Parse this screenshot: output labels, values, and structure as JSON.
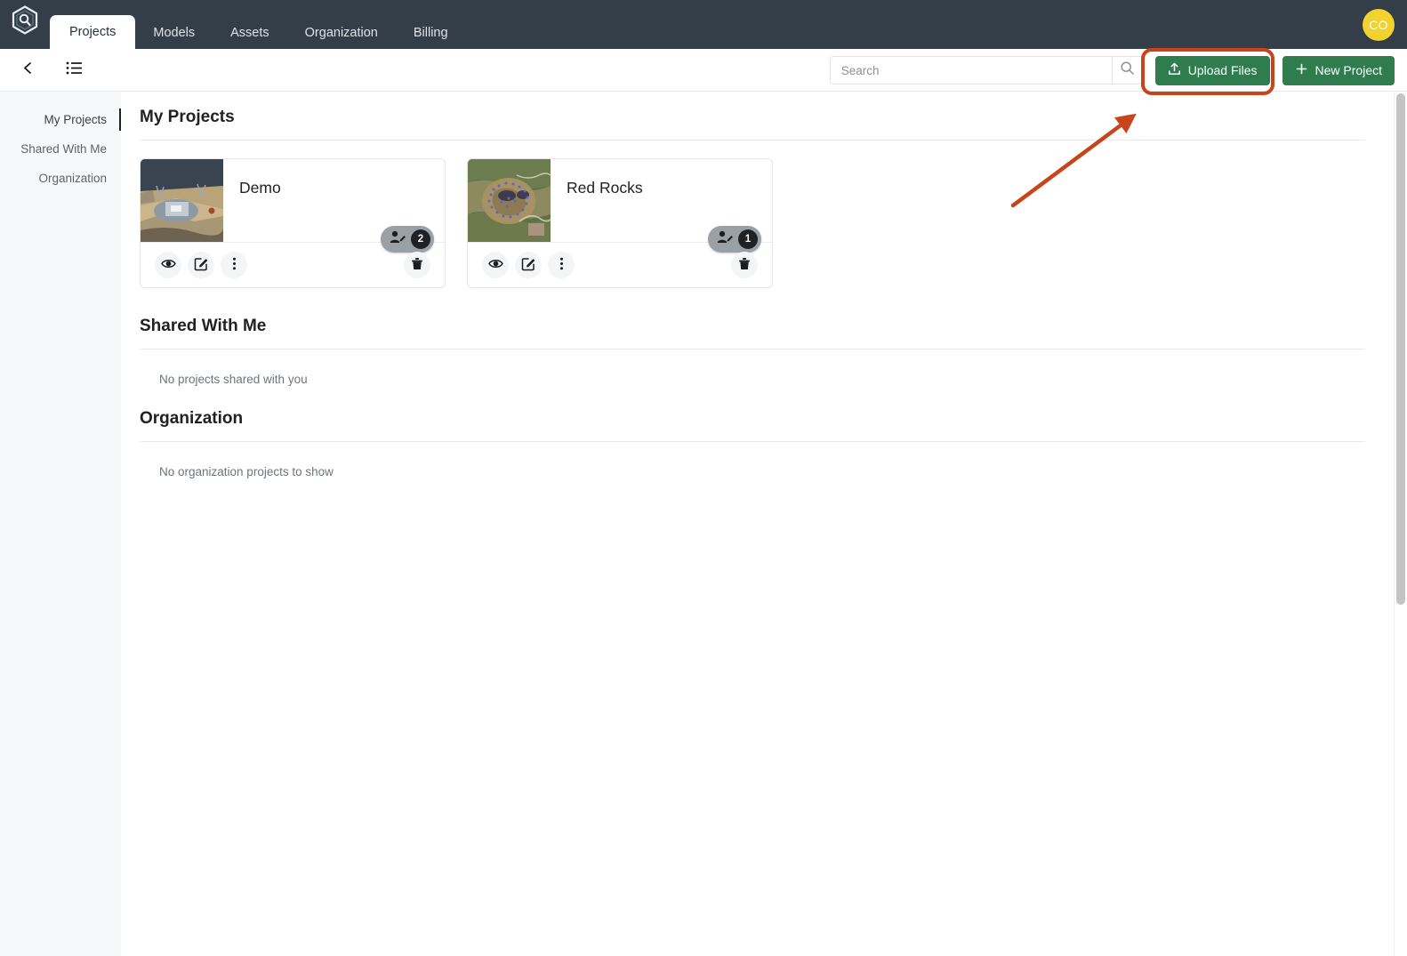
{
  "topnav": {
    "logo_icon": "hexagon-magnifier-logo",
    "tabs": [
      {
        "label": "Projects",
        "active": true
      },
      {
        "label": "Models",
        "active": false
      },
      {
        "label": "Assets",
        "active": false
      },
      {
        "label": "Organization",
        "active": false
      },
      {
        "label": "Billing",
        "active": false
      }
    ],
    "avatar_initials": "CO",
    "avatar_color": "#f2d22e",
    "background": "#333e48"
  },
  "toolbar": {
    "back_icon": "chevron-left-icon",
    "list_icon": "list-view-icon",
    "search": {
      "placeholder": "Search",
      "value": "",
      "button_icon": "search-icon"
    },
    "upload_label": "Upload Files",
    "upload_icon": "upload-icon",
    "new_project_label": "New Project",
    "new_project_icon": "plus-icon",
    "button_color": "#2f7d4f"
  },
  "sidebar": {
    "items": [
      {
        "label": "My Projects",
        "active": true
      },
      {
        "label": "Shared With Me",
        "active": false
      },
      {
        "label": "Organization",
        "active": false
      }
    ]
  },
  "main": {
    "sections": [
      {
        "title": "My Projects",
        "empty_text": "",
        "projects": [
          {
            "name": "Demo",
            "share_count": "2",
            "thumbnail": "aerial-site-scan-thumbnail",
            "view_icon": "eye-icon",
            "edit_icon": "pencil-square-icon",
            "more_icon": "more-vertical-icon",
            "delete_icon": "trash-icon",
            "share_icon": "person-edit-icon"
          },
          {
            "name": "Red Rocks",
            "share_count": "1",
            "thumbnail": "satellite-map-thumbnail",
            "view_icon": "eye-icon",
            "edit_icon": "pencil-square-icon",
            "more_icon": "more-vertical-icon",
            "delete_icon": "trash-icon",
            "share_icon": "person-edit-icon"
          }
        ]
      },
      {
        "title": "Shared With Me",
        "empty_text": "No projects shared with you",
        "projects": []
      },
      {
        "title": "Organization",
        "empty_text": "No organization projects to show",
        "projects": []
      }
    ]
  },
  "annotation": {
    "highlight_color": "#c8441a",
    "target": "upload-files-button",
    "shapes": [
      "rounded-rectangle-highlight",
      "pointer-arrow"
    ]
  }
}
